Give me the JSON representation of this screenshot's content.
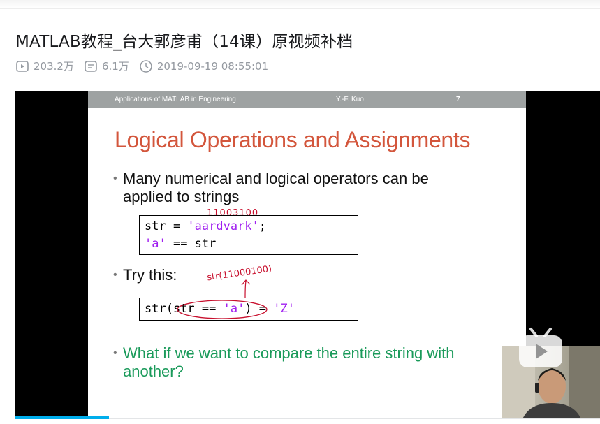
{
  "video": {
    "title": "MATLAB教程_台大郭彦甫（14课）原视频补档",
    "views": "203.2万",
    "danmaku": "6.1万",
    "publish_time": "2019-09-19 08:55:01"
  },
  "slide": {
    "header_left": "Applications of MATLAB in Engineering",
    "header_center": "Y.-F. Kuo",
    "header_page": "7",
    "title": "Logical Operations and Assignments",
    "bullet1_line1": "Many numerical and logical operators can be",
    "bullet1_line2": "applied to strings",
    "code1": {
      "l1_a": "str = ",
      "l1_str": "'aardvark'",
      "l1_b": ";",
      "l2_str": "'a'",
      "l2_b": " == str"
    },
    "bullet2": "Try this:",
    "code2": {
      "a": "str(str == ",
      "s1": "'a'",
      "b": ") = ",
      "s2": "'Z'"
    },
    "bullet3_line1": "What if we want to compare the entire string with",
    "bullet3_line2": "another?",
    "annotation_bits": "11003100",
    "annotation_str": "str(11000100)"
  },
  "colors": {
    "accent_progress": "#00aeec",
    "slide_title": "#d3563c",
    "bullet_green": "#1a9a5a",
    "string_purple": "#a020f0",
    "annotation_red": "#c8102e"
  }
}
